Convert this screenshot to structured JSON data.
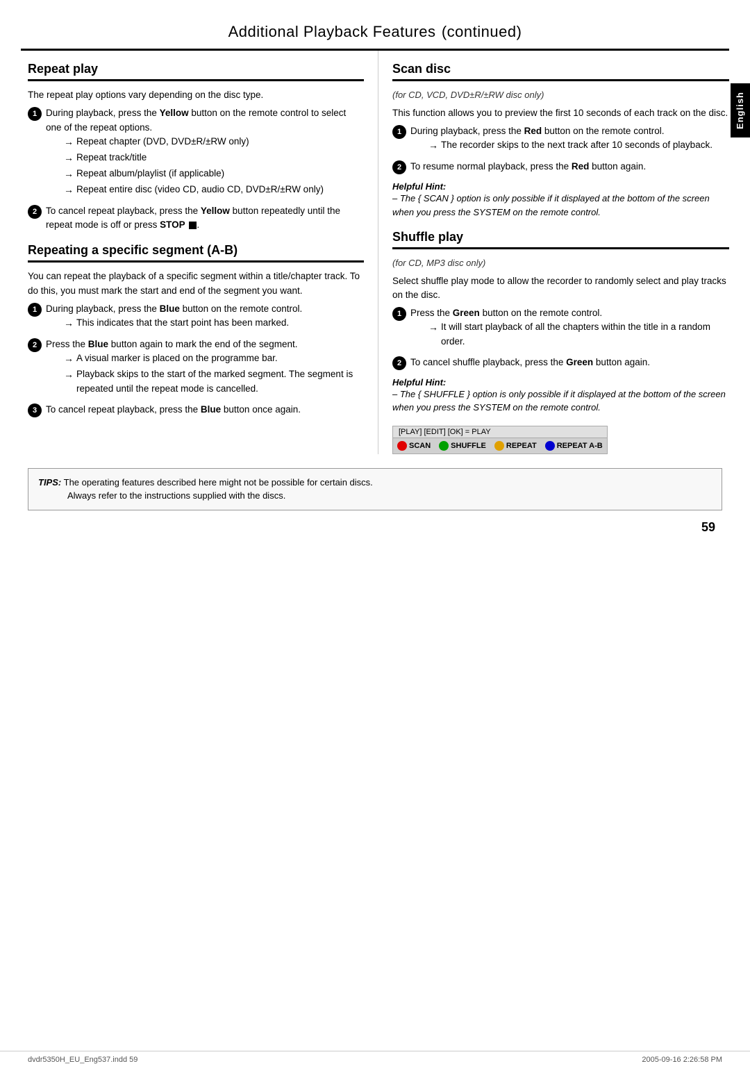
{
  "header": {
    "title": "Additional Playback Features",
    "subtitle": "continued"
  },
  "english_tab": "English",
  "left": {
    "repeat_play": {
      "title": "Repeat play",
      "intro": "The repeat play options vary depending on the disc type.",
      "step1": {
        "num": "1",
        "text1": "During playback, press the ",
        "bold1": "Yellow",
        "text2": " button on the remote control to select one of the repeat options.",
        "arrows": [
          "Repeat chapter (DVD, DVD±R/±RW only)",
          "Repeat track/title",
          "Repeat album/playlist (if applicable)",
          "Repeat entire disc (video CD, audio CD, DVD±R/±RW only)"
        ]
      },
      "step2": {
        "num": "2",
        "text1": "To cancel repeat playback, press the ",
        "bold1": "Yellow",
        "text2": " button repeatedly until the repeat mode is off or press ",
        "bold2": "STOP",
        "text3": " ■."
      }
    },
    "repeating_segment": {
      "title": "Repeating a specific segment (A-B)",
      "intro": "You can repeat the playback of a specific segment within a title/chapter track. To do this, you must mark the start and end of the segment you want.",
      "step1": {
        "num": "1",
        "text1": "During playback, press the ",
        "bold1": "Blue",
        "text2": " button on the remote control.",
        "arrow": "This indicates that the start point has been marked."
      },
      "step2": {
        "num": "2",
        "text1": "Press the ",
        "bold1": "Blue",
        "text2": " button again to mark the end of the segment.",
        "arrows": [
          "A visual marker is placed on the programme bar.",
          "Playback skips to the start of the marked segment. The segment is repeated until the repeat mode is cancelled."
        ]
      },
      "step3": {
        "num": "3",
        "text1": "To cancel repeat playback, press the ",
        "bold1": "Blue",
        "text2": " button once again."
      }
    }
  },
  "right": {
    "scan_disc": {
      "title": "Scan disc",
      "subtitle": "(for CD, VCD, DVD±R/±RW disc only)",
      "intro": "This function allows you to preview the first 10 seconds of each track on the disc.",
      "step1": {
        "num": "1",
        "text1": "During playback, press the ",
        "bold1": "Red",
        "text2": " button on the remote control.",
        "arrow": "The recorder skips to the next track after 10 seconds of playback."
      },
      "step2": {
        "num": "2",
        "text1": "To resume normal playback, press the ",
        "bold1": "Red",
        "text2": " button again."
      },
      "helpful_hint": {
        "title": "Helpful Hint:",
        "text": "– The { SCAN } option is only possible if it displayed at the bottom of the screen when you press the SYSTEM on the remote control."
      }
    },
    "shuffle_play": {
      "title": "Shuffle play",
      "subtitle": "(for CD, MP3 disc only)",
      "intro": "Select shuffle play mode to allow the recorder to randomly select and play tracks on the disc.",
      "step1": {
        "num": "1",
        "text1": "Press the ",
        "bold1": "Green",
        "text2": " button on the remote control.",
        "arrow": "It will start playback of all the chapters within the title in a random order."
      },
      "step2": {
        "num": "2",
        "text1": "To cancel shuffle playback, press the ",
        "bold1": "Green",
        "text2": " button again."
      },
      "helpful_hint": {
        "title": "Helpful Hint:",
        "text": "– The { SHUFFLE } option is only possible if it displayed at the bottom of the screen when you press the SYSTEM on the remote control."
      },
      "button_bar": {
        "top": "[PLAY] [EDIT] [OK] = PLAY",
        "buttons": [
          {
            "color": "red",
            "label": "SCAN"
          },
          {
            "color": "green",
            "label": "SHUFFLE"
          },
          {
            "color": "yellow",
            "label": "REPEAT"
          },
          {
            "color": "blue",
            "label": "REPEAT A-B"
          }
        ]
      }
    }
  },
  "tips": {
    "label": "TIPS:",
    "text1": "The operating features described here might not be possible for certain discs.",
    "text2": "Always refer to the instructions supplied with the discs."
  },
  "footer": {
    "left": "dvdr5350H_EU_Eng537.indd  59",
    "right": "2005-09-16  2:26:58 PM"
  },
  "page_number": "59"
}
